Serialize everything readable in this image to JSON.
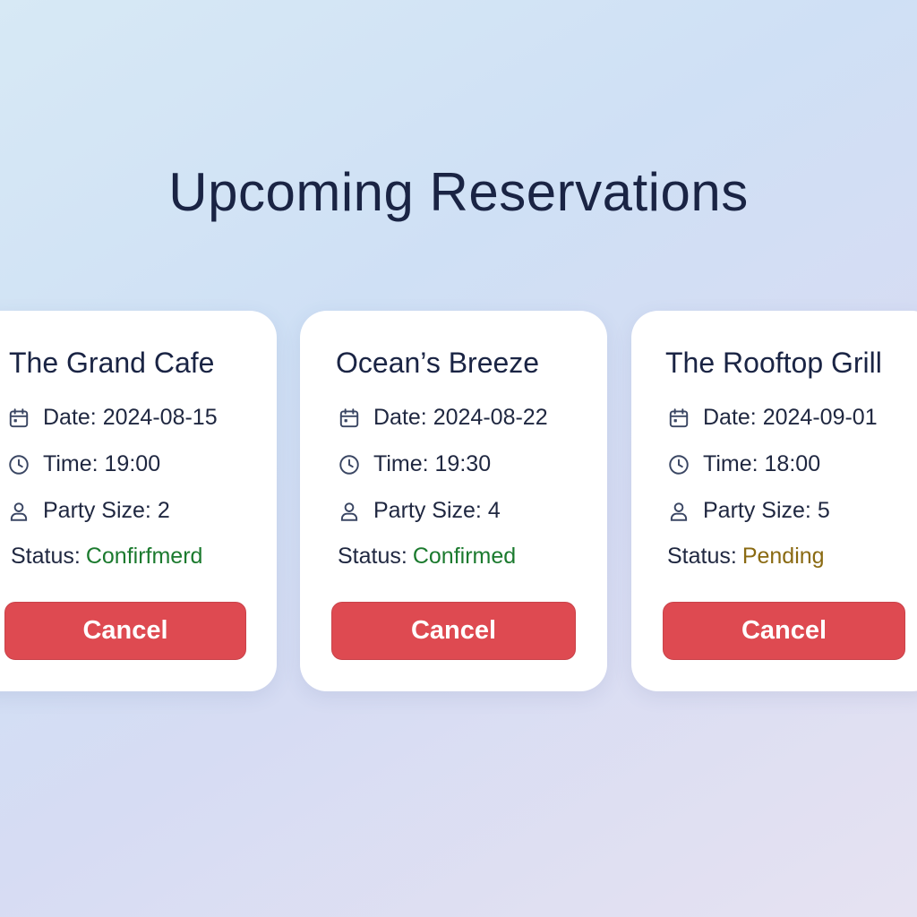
{
  "title": "Upcoming Reservations",
  "labels": {
    "date": "Date:",
    "time": "Time:",
    "party": "Party Size:",
    "status": "Status:"
  },
  "colors": {
    "confirmed": "#1b7a2e",
    "pending": "#8a6a12",
    "cancel_button": "#de4a51"
  },
  "reservations": [
    {
      "name": "The Grand Cafe",
      "date": "2024-08-15",
      "time": "19:00",
      "party_size": "2",
      "status": "Confirfmerd",
      "cancel_label": "Cancel"
    },
    {
      "name": "Ocean’s Breeze",
      "date": "2024-08-22",
      "time": "19:30",
      "party_size": "4",
      "status": "Confirmed",
      "cancel_label": "Cancel"
    },
    {
      "name": "The Rooftop Grill",
      "date": "2024-09-01",
      "time": "18:00",
      "party_size": "5",
      "status": "Pending",
      "cancel_label": "Cancel"
    }
  ]
}
